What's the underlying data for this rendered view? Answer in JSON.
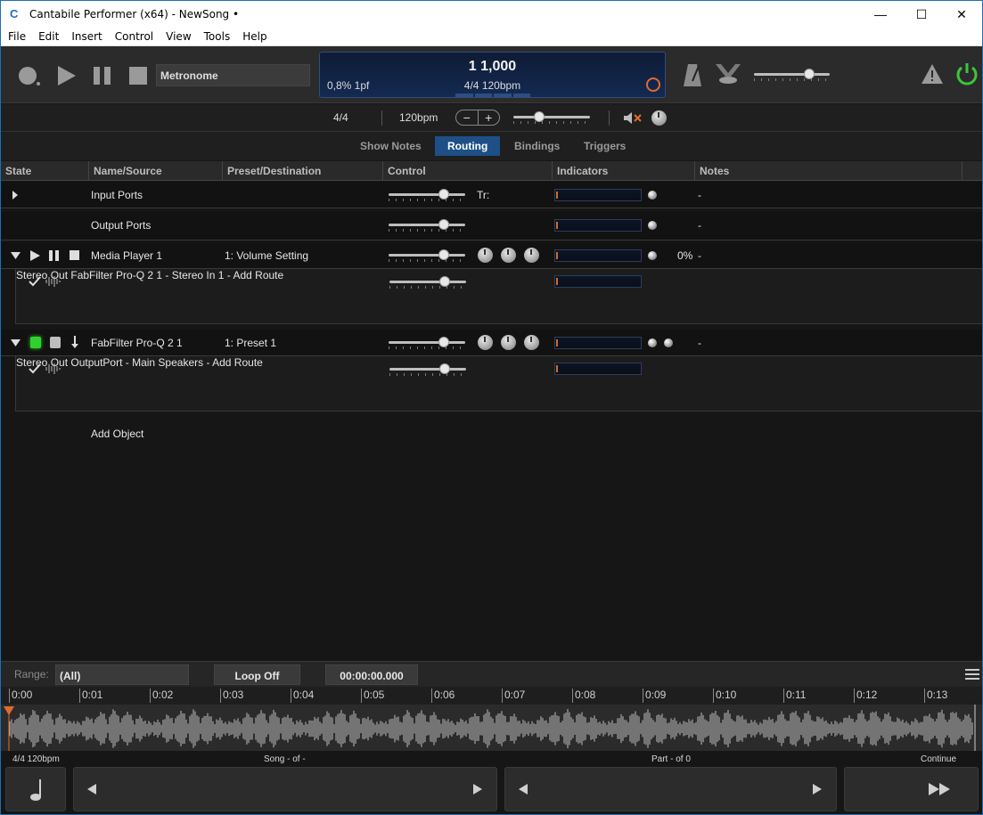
{
  "titlebar": {
    "title": "Cantabile Performer (x64) - NewSong •",
    "minimize": "—",
    "maximize": "☐",
    "close": "✕"
  },
  "menu": [
    "File",
    "Edit",
    "Insert",
    "Control",
    "View",
    "Tools",
    "Help"
  ],
  "transport": {
    "metronome_label": "Metronome",
    "lcd": {
      "position": "1 1,000",
      "load": "0,8%  1pf",
      "tempo": "4/4 120bpm"
    },
    "master_level": 0.8
  },
  "tempo_strip": {
    "time_sig": "4/4",
    "bpm": "120bpm",
    "minus": "−",
    "plus": "+",
    "slider_level": 0.35
  },
  "tabs": [
    {
      "label": "Show Notes",
      "active": false
    },
    {
      "label": "Routing",
      "active": true
    },
    {
      "label": "Bindings",
      "active": false
    },
    {
      "label": "Triggers",
      "active": false
    }
  ],
  "columns": [
    "State",
    "Name/Source",
    "Preset/Destination",
    "Control",
    "Indicators",
    "Notes"
  ],
  "rows": {
    "input_ports": {
      "name": "Input Ports",
      "control_text": "Tr:",
      "notes": "-"
    },
    "output_ports": {
      "name": "Output Ports",
      "notes": "-"
    },
    "media_player": {
      "name": "Media Player 1",
      "preset": "1: Volume Setting",
      "percent": "0%",
      "notes": "-"
    },
    "mp_stereo_out": {
      "name": "Stereo Out",
      "dest": "FabFilter Pro-Q 2 1 - Stereo In 1",
      "notes": "-"
    },
    "mp_add_route": {
      "label": "Add Route"
    },
    "fabfilter": {
      "name": "FabFilter Pro-Q 2 1",
      "preset": "1: Preset 1",
      "notes": "-"
    },
    "ff_stereo_out": {
      "name": "Stereo Out",
      "dest": "OutputPort - Main Speakers",
      "notes": "-"
    },
    "ff_add_route": {
      "label": "Add Route"
    },
    "add_object": {
      "label": "Add Object"
    }
  },
  "timeline": {
    "range_label": "Range:",
    "range_value": "(All)",
    "loop": "Loop Off",
    "time": "00:00:00.000",
    "ticks": [
      "0:00",
      "0:01",
      "0:02",
      "0:03",
      "0:04",
      "0:05",
      "0:06",
      "0:07",
      "0:08",
      "0:09",
      "0:10",
      "0:11",
      "0:12",
      "0:13"
    ]
  },
  "footer": {
    "tempo": "4/4 120bpm",
    "song": "Song - of -",
    "part": "Part - of 0",
    "continue": "Continue"
  },
  "colors": {
    "accent": "#1e4f86",
    "power": "#3ec43e",
    "orange": "#e06b2d"
  }
}
